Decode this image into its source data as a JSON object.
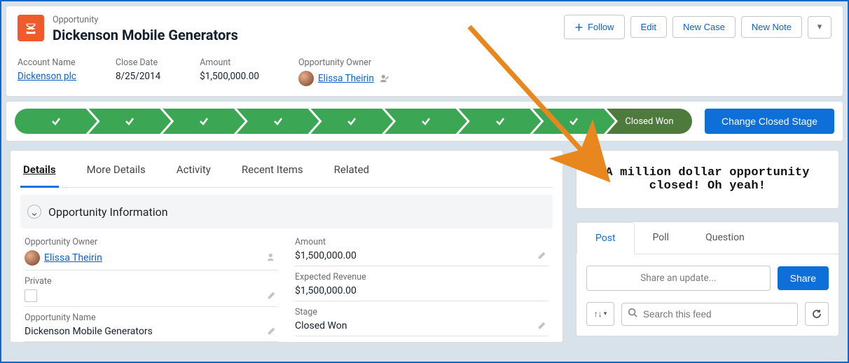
{
  "header": {
    "object_label": "Opportunity",
    "title": "Dickenson Mobile Generators",
    "actions": {
      "follow": "Follow",
      "edit": "Edit",
      "new_case": "New Case",
      "new_note": "New Note"
    }
  },
  "meta": {
    "account_name_label": "Account Name",
    "account_name_value": "Dickenson plc",
    "close_date_label": "Close Date",
    "close_date_value": "8/25/2014",
    "amount_label": "Amount",
    "amount_value": "$1,500,000.00",
    "owner_label": "Opportunity Owner",
    "owner_value": "Elissa Theirin"
  },
  "path": {
    "final_label": "Closed Won",
    "change_button": "Change Closed Stage"
  },
  "record_tabs": {
    "details": "Details",
    "more_details": "More Details",
    "activity": "Activity",
    "recent_items": "Recent Items",
    "related": "Related"
  },
  "section_title": "Opportunity Information",
  "details": {
    "owner_label": "Opportunity Owner",
    "owner_value": "Elissa Theirin",
    "private_label": "Private",
    "opp_name_label": "Opportunity Name",
    "opp_name_value": "Dickenson Mobile Generators",
    "amount_label": "Amount",
    "amount_value": "$1,500,000.00",
    "exp_rev_label": "Expected Revenue",
    "exp_rev_value": "$1,500,000.00",
    "stage_label": "Stage",
    "stage_value": "Closed Won"
  },
  "brag_text": "A million dollar opportunity closed! Oh yeah!",
  "feed": {
    "tab_post": "Post",
    "tab_poll": "Poll",
    "tab_question": "Question",
    "compose_placeholder": "Share an update...",
    "share_button": "Share",
    "search_placeholder": "Search this feed"
  }
}
